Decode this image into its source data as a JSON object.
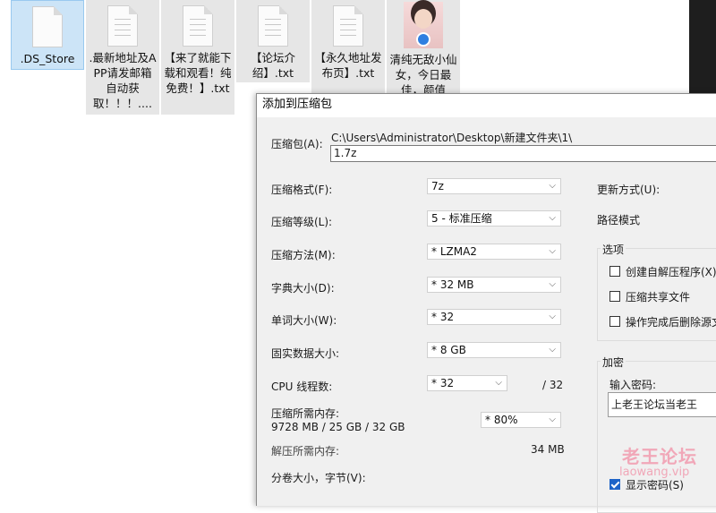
{
  "desktop": {
    "files": [
      {
        "name": ".DS_Store"
      },
      {
        "name": ".最新地址及APP请发邮箱自动获取！！！...."
      },
      {
        "name": "【来了就能下载和观看！纯免费！】.txt"
      },
      {
        "name": "【论坛介绍】.txt"
      },
      {
        "name": "【永久地址发布页】.txt"
      },
      {
        "name": "清纯无敌小仙女，今日最佳，颜值"
      }
    ]
  },
  "dialog": {
    "title": "添加到压缩包",
    "archive_label": "压缩包(A):",
    "archive_path": "C:\\Users\\Administrator\\Desktop\\新建文件夹\\1\\",
    "archive_name": "1.7z",
    "format_label": "压缩格式(F):",
    "format_value": "7z",
    "level_label": "压缩等级(L):",
    "level_value": "5 - 标准压缩",
    "method_label": "压缩方法(M):",
    "method_value": "*  LZMA2",
    "dict_label": "字典大小(D):",
    "dict_value": "*  32 MB",
    "word_label": "单词大小(W):",
    "word_value": "*  32",
    "solid_label": "固实数据大小:",
    "solid_value": "*  8 GB",
    "cpu_label": "CPU 线程数:",
    "cpu_value": "*  32",
    "cpu_total": "/ 32",
    "mem_label": "压缩所需内存:",
    "mem_value": "9728 MB / 25 GB / 32 GB",
    "mem_percent": "*  80%",
    "decomp_label": "解压所需内存:",
    "decomp_value": "34 MB",
    "volume_label": "分卷大小，字节(V):",
    "update_label": "更新方式(U):",
    "pathmode_label": "路径模式",
    "options_group": "选项",
    "opt_sfx": "创建自解压程序(X)",
    "opt_shared": "压缩共享文件",
    "opt_delete": "操作完成后删除源文",
    "encrypt_group": "加密",
    "password_label": "输入密码:",
    "password_value": "上老王论坛当老王",
    "show_password": "显示密码(S)"
  },
  "watermark": {
    "text": "老王论坛",
    "url": "laowang.vip"
  }
}
